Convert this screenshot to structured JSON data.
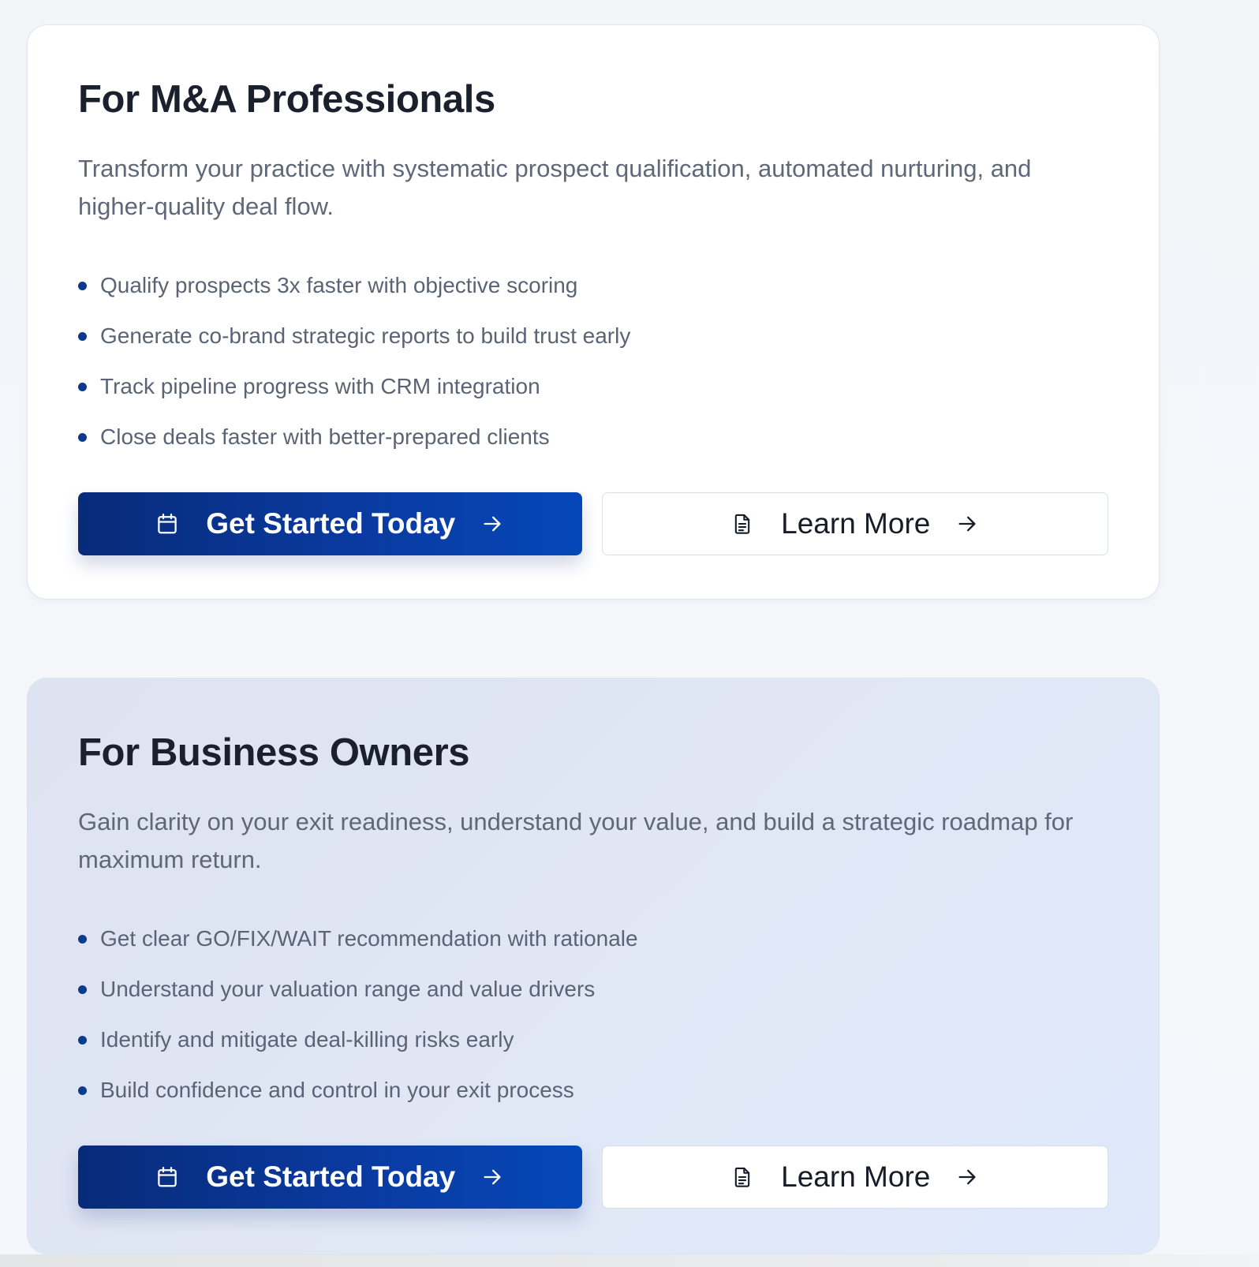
{
  "sections": [
    {
      "title": "For M&A Professionals",
      "description": "Transform your practice with systematic prospect qualification, automated nurturing, and higher-quality deal flow.",
      "bullets": [
        "Qualify prospects 3x faster with objective scoring",
        "Generate co-brand strategic reports to build trust early",
        "Track pipeline progress with CRM integration",
        "Close deals faster with better-prepared clients"
      ],
      "primary_button": {
        "label": "Get Started Today",
        "icon": "calendar-icon",
        "trail_icon": "arrow-right-icon"
      },
      "secondary_button": {
        "label": "Learn More",
        "icon": "document-icon",
        "trail_icon": "arrow-right-icon"
      }
    },
    {
      "title": "For Business Owners",
      "description": "Gain clarity on your exit readiness, understand your value, and build a strategic roadmap for maximum return.",
      "bullets": [
        "Get clear GO/FIX/WAIT recommendation with rationale",
        "Understand your valuation range and value drivers",
        "Identify and mitigate deal-killing risks early",
        "Build confidence and control in your exit process"
      ],
      "primary_button": {
        "label": "Get Started Today",
        "icon": "calendar-icon",
        "trail_icon": "arrow-right-icon"
      },
      "secondary_button": {
        "label": "Learn More",
        "icon": "document-icon",
        "trail_icon": "arrow-right-icon"
      }
    }
  ],
  "colors": {
    "primary": "#0a3aa0",
    "bullet_dot": "#0b3a8f",
    "heading": "#1a202c",
    "body_text": "#5e6878"
  }
}
